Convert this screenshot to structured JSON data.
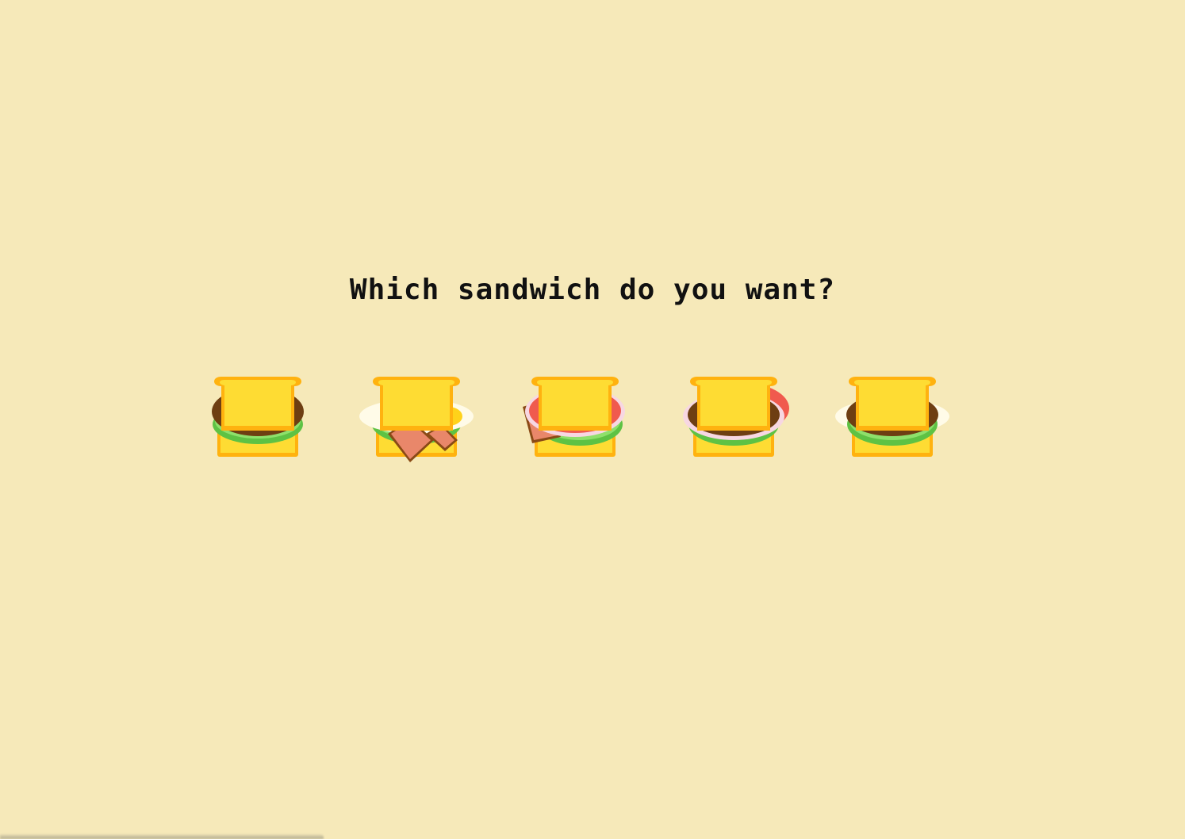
{
  "prompt": {
    "text": "Which sandwich do you want?"
  },
  "colors": {
    "background": "#f6e9b9",
    "bread": "#fedc33",
    "bread_crust": "#ffb20f",
    "lettuce": "#8ee06b",
    "lettuce_dark": "#5ec244",
    "patty": "#6e3e12",
    "ham": "#e9876a",
    "ham_edge": "#8a4a16",
    "tomato": "#f05a4e",
    "onion": "#f7d7e2",
    "egg_white": "#fffbe8",
    "egg_yolk": "#ffd21a"
  },
  "sandwiches": [
    {
      "id": "s1",
      "icon": "sandwich-lettuce-patty-icon",
      "fillings": [
        "lettuce",
        "patty"
      ]
    },
    {
      "id": "s2",
      "icon": "sandwich-egg-ham-lettuce-icon",
      "fillings": [
        "lettuce",
        "egg",
        "ham"
      ]
    },
    {
      "id": "s3",
      "icon": "sandwich-ham-tomato-onion-lettuce-icon",
      "fillings": [
        "lettuce",
        "ham",
        "tomato",
        "onion"
      ]
    },
    {
      "id": "s4",
      "icon": "sandwich-lettuce-patty-onion-tomato-icon",
      "fillings": [
        "lettuce",
        "tomato",
        "onion",
        "patty"
      ]
    },
    {
      "id": "s5",
      "icon": "sandwich-egg-lettuce-patty-icon",
      "fillings": [
        "lettuce",
        "egg",
        "patty"
      ]
    }
  ]
}
